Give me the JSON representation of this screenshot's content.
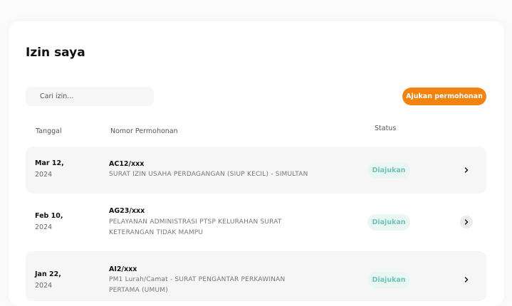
{
  "page": {
    "title": "Izin saya"
  },
  "search": {
    "placeholder": "Cari izin..."
  },
  "actions": {
    "apply_label": "Ajukan permohonan"
  },
  "table": {
    "headers": {
      "date": "Tanggal",
      "number": "Nomor Permohonan",
      "status": "Status"
    },
    "rows": [
      {
        "date_md": "Mar 12,",
        "date_year": "2024",
        "code": "AC12/xxx",
        "desc_1": "SURAT IZIN USAHA PERDAGANGAN (SIUP KECIL) - SIMULTAN",
        "desc_2": "",
        "status": "Diajukan",
        "icon": "chevron-right-icon"
      },
      {
        "date_md": "Feb 10,",
        "date_year": "2024",
        "code": "AG23/xxx",
        "desc_1": "PELAYANAN ADMINISTRASI PTSP KELURAHAN SURAT",
        "desc_2": "KETERANGAN TIDAK MAMPU",
        "status": "Diajukan",
        "icon": "chevron-right-icon"
      },
      {
        "date_md": "Jan 22,",
        "date_year": "2024",
        "code": "AI2/xxx",
        "desc_1": "PM1 Lurah/Camat - SURAT PENGANTAR PERKAWINAN",
        "desc_2": "PERTAMA (UMUM)",
        "status": "Diajukan",
        "icon": "chevron-right-icon"
      }
    ]
  },
  "colors": {
    "accent": "#f2830f",
    "status_text": "#6fc3b6",
    "status_bg": "#eaf6f4",
    "row_bg": "#f6f6f6"
  }
}
